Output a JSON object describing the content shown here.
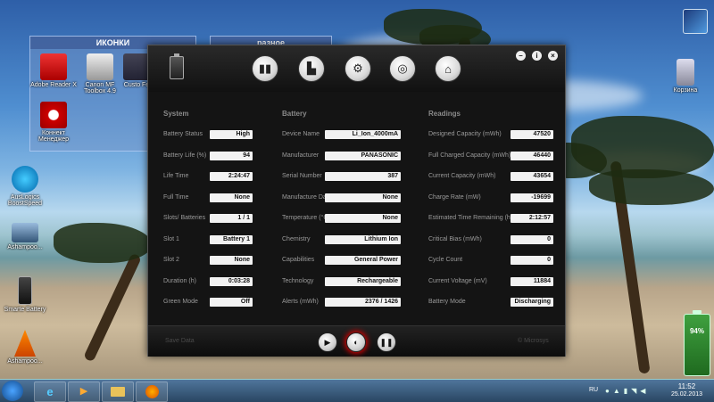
{
  "desktop": {
    "group_icons_title": "ИКОНКИ",
    "group_misc_title": "разное",
    "icons": {
      "adobe": "Adobe Reader X",
      "canon": "Canon MF Toolbox 4.9",
      "custom": "Custo Fe",
      "konnekt": "Коннект Менеджер",
      "auslogics": "AusLogics BoostSpeed",
      "ashampoo1": "Ashampoo...",
      "smarte": "Smarte Battery",
      "ashampoo2": "Ashampoo...",
      "recycle": "Корзина"
    },
    "battery_gadget_percent": "94%"
  },
  "app": {
    "window_controls": {
      "minimize": "–",
      "info": "i",
      "close": "×"
    },
    "toolbar_icons": [
      "battery-icon",
      "bar-chart-icon",
      "gear-icon",
      "target-icon",
      "home-icon"
    ],
    "system": {
      "title": "System",
      "rows": [
        {
          "label": "Battery Status",
          "value": "High"
        },
        {
          "label": "Battery Life (%)",
          "value": "94"
        },
        {
          "label": "Life Time",
          "value": "2:24:47"
        },
        {
          "label": "Full Time",
          "value": "None"
        },
        {
          "label": "Slots/ Batteries",
          "value": "1 / 1"
        },
        {
          "label": "Slot 1",
          "value": "Battery 1"
        },
        {
          "label": "Slot 2",
          "value": "None"
        },
        {
          "label": "Duration (h)",
          "value": "0:03:28"
        },
        {
          "label": "Green Mode",
          "value": "Off"
        }
      ]
    },
    "battery": {
      "title": "Battery",
      "rows": [
        {
          "label": "Device Name",
          "value": "Li_Ion_4000mA"
        },
        {
          "label": "Manufacturer",
          "value": "PANASONIC"
        },
        {
          "label": "Serial Number",
          "value": "387"
        },
        {
          "label": "Manufacture Date",
          "value": "None"
        },
        {
          "label": "Temperature (°C)",
          "value": "None"
        },
        {
          "label": "Chemistry",
          "value": "Lithium Ion"
        },
        {
          "label": "Capabilities",
          "value": "General Power"
        },
        {
          "label": "Technology",
          "value": "Rechargeable"
        },
        {
          "label": "Alerts (mWh)",
          "value": "2376 / 1426"
        }
      ]
    },
    "readings": {
      "title": "Readings",
      "rows": [
        {
          "label": "Designed Capacity  (mWh)",
          "value": "47520"
        },
        {
          "label": "Full Charged Capacity  (mWh)",
          "value": "46440"
        },
        {
          "label": "Current Capacity (mWh)",
          "value": "43654"
        },
        {
          "label": "Charge Rate (mW)",
          "value": "-19699"
        },
        {
          "label": "Estimated Time Remaining (h)",
          "value": "2:12:57"
        },
        {
          "label": "Critical Bias (mWh)",
          "value": "0"
        },
        {
          "label": "Cycle Count",
          "value": "0"
        },
        {
          "label": "Current Voltage (mV)",
          "value": "11884"
        },
        {
          "label": "Battery Mode",
          "value": "Discharging"
        }
      ]
    },
    "footer": {
      "save_data": "Save Data",
      "copyright": "© Microsys"
    }
  },
  "taskbar": {
    "lang": "RU",
    "time": "11:52",
    "date": "25.02.2013"
  }
}
